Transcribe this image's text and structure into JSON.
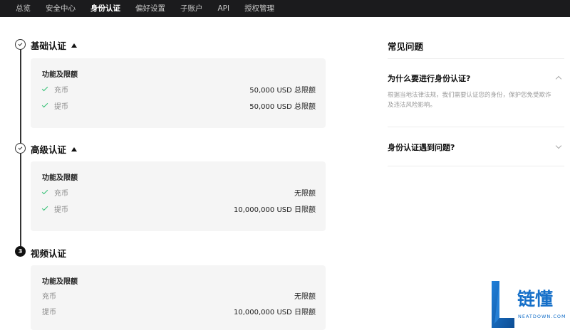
{
  "nav": {
    "items": [
      {
        "label": "总览",
        "active": false
      },
      {
        "label": "安全中心",
        "active": false
      },
      {
        "label": "身份认证",
        "active": true
      },
      {
        "label": "偏好设置",
        "active": false
      },
      {
        "label": "子账户",
        "active": false
      },
      {
        "label": "API",
        "active": false
      },
      {
        "label": "授权管理",
        "active": false
      }
    ]
  },
  "steps": [
    {
      "title": "基础认证",
      "status": "done",
      "card_heading": "功能及限额",
      "rows": [
        {
          "label": "充币",
          "value": "50,000 USD 总限额"
        },
        {
          "label": "提币",
          "value": "50,000 USD 总限额"
        }
      ]
    },
    {
      "title": "高级认证",
      "status": "done",
      "card_heading": "功能及限额",
      "rows": [
        {
          "label": "充币",
          "value": "无限额"
        },
        {
          "label": "提币",
          "value": "10,000,000 USD 日限额"
        }
      ]
    },
    {
      "title": "视频认证",
      "status": "current",
      "number": "3",
      "card_heading": "功能及限额",
      "rows": [
        {
          "label": "充币",
          "value": "无限额"
        },
        {
          "label": "提币",
          "value": "10,000,000 USD 日限额"
        }
      ]
    }
  ],
  "faq": {
    "title": "常见问题",
    "items": [
      {
        "question": "为什么要进行身份认证?",
        "answer": "根据当地法律法规，我们需要认证您的身份，保护您免受欺诈及违法风险影响。",
        "expanded": true
      },
      {
        "question": "身份认证遇到问题?",
        "answer": "",
        "expanded": false
      }
    ]
  },
  "watermark": {
    "text": "链懂",
    "subtext": "NEATDOWN.COM"
  },
  "colors": {
    "nav_bg": "#1b1b1d",
    "check_green": "#2fbf71",
    "card_bg": "#f5f5f5",
    "brand_blue": "#1670c9"
  }
}
